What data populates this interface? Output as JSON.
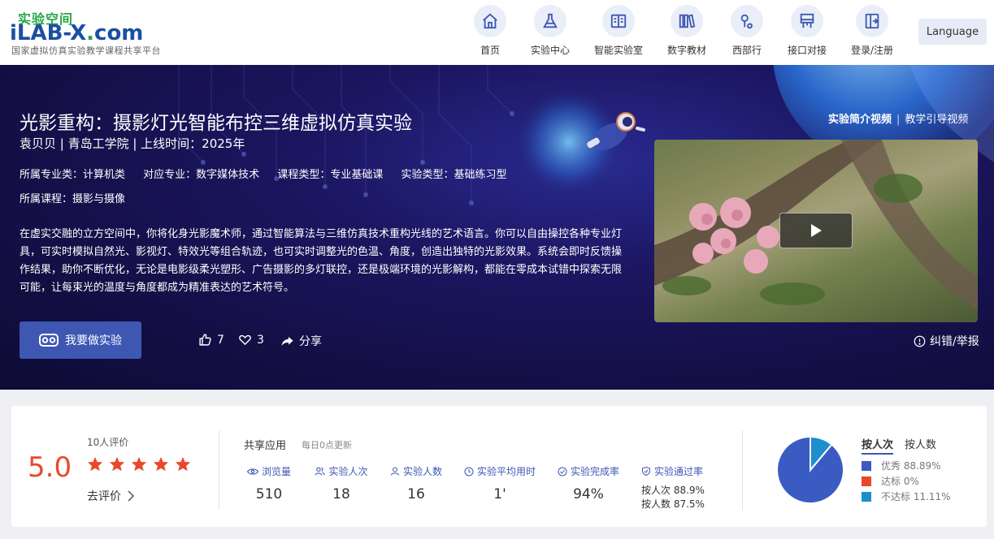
{
  "logo": {
    "cn": "实验空间",
    "main_pre": "iLAB-X",
    "main_dot": ".",
    "main_post": "com",
    "subtitle": "国家虚拟仿真实验教学课程共享平台"
  },
  "nav": [
    {
      "label": "首页",
      "icon": "home-icon"
    },
    {
      "label": "实验中心",
      "icon": "flask-icon"
    },
    {
      "label": "智能实验室",
      "icon": "book-icon"
    },
    {
      "label": "数字教材",
      "icon": "books-icon"
    },
    {
      "label": "西部行",
      "icon": "location-icon"
    },
    {
      "label": "接口对接",
      "icon": "interface-icon"
    },
    {
      "label": "登录/注册",
      "icon": "login-icon"
    }
  ],
  "language": "Language",
  "experiment": {
    "title": "光影重构：摄影灯光智能布控三维虚拟仿真实验",
    "meta": "袁贝贝 | 青岛工学院 | 上线时间：2025年",
    "tags": [
      "所属专业类：计算机类",
      "对应专业：数字媒体技术",
      "课程类型：专业基础课",
      "实验类型：基础练习型"
    ],
    "course": "所属课程：摄影与摄像",
    "description": "在虚实交融的立方空间中，你将化身光影魔术师，通过智能算法与三维仿真技术重构光线的艺术语言。你可以自由操控各种专业灯具，可实时模拟自然光、影视灯、特效光等组合轨迹，也可实时调整光的色温、角度，创造出独特的光影效果。系统会即时反馈操作结果，助你不断优化，无论是电影级柔光塑形、广告摄影的多灯联控，还是极端环境的光影解构，都能在零成本试错中探索无限可能，让每束光的温度与角度都成为精准表达的艺术符号。",
    "do_button": "我要做实验",
    "likes": "7",
    "favorites": "3",
    "share": "分享",
    "video_tabs": [
      "实验简介视频",
      "教学引导视频"
    ],
    "video_tab_sep": "|",
    "report": "纠错/举报"
  },
  "stats": {
    "score": "5.0",
    "review_count": "10人评价",
    "stars": 5,
    "go_review": "去评价",
    "share_title": "共享应用",
    "share_sub": "每日0点更新",
    "metrics": [
      {
        "label": "浏览量",
        "value": "510",
        "icon": "eye-icon"
      },
      {
        "label": "实验人次",
        "value": "18",
        "icon": "users-icon"
      },
      {
        "label": "实验人数",
        "value": "16",
        "icon": "user-icon"
      },
      {
        "label": "实验平均用时",
        "value": "1'",
        "icon": "clock-icon"
      },
      {
        "label": "实验完成率",
        "value": "94%",
        "icon": "check-circle-icon"
      },
      {
        "label": "实验通过率",
        "value": "",
        "icon": "shield-icon"
      }
    ],
    "pass_by_times": "按人次 88.9%",
    "pass_by_people": "按人数 87.5%",
    "pie_tabs": [
      "按人次",
      "按人数"
    ],
    "legend": [
      {
        "label": "优秀 88.89%",
        "color": "#3a5bc2"
      },
      {
        "label": "达标 0%",
        "color": "#e9482a"
      },
      {
        "label": "不达标 11.11%",
        "color": "#1d8fcc"
      }
    ]
  },
  "chart_data": {
    "type": "pie",
    "categories": [
      "优秀",
      "达标",
      "不达标"
    ],
    "values": [
      88.89,
      0,
      11.11
    ],
    "colors": [
      "#3a5bc2",
      "#e9482a",
      "#1d8fcc"
    ]
  }
}
